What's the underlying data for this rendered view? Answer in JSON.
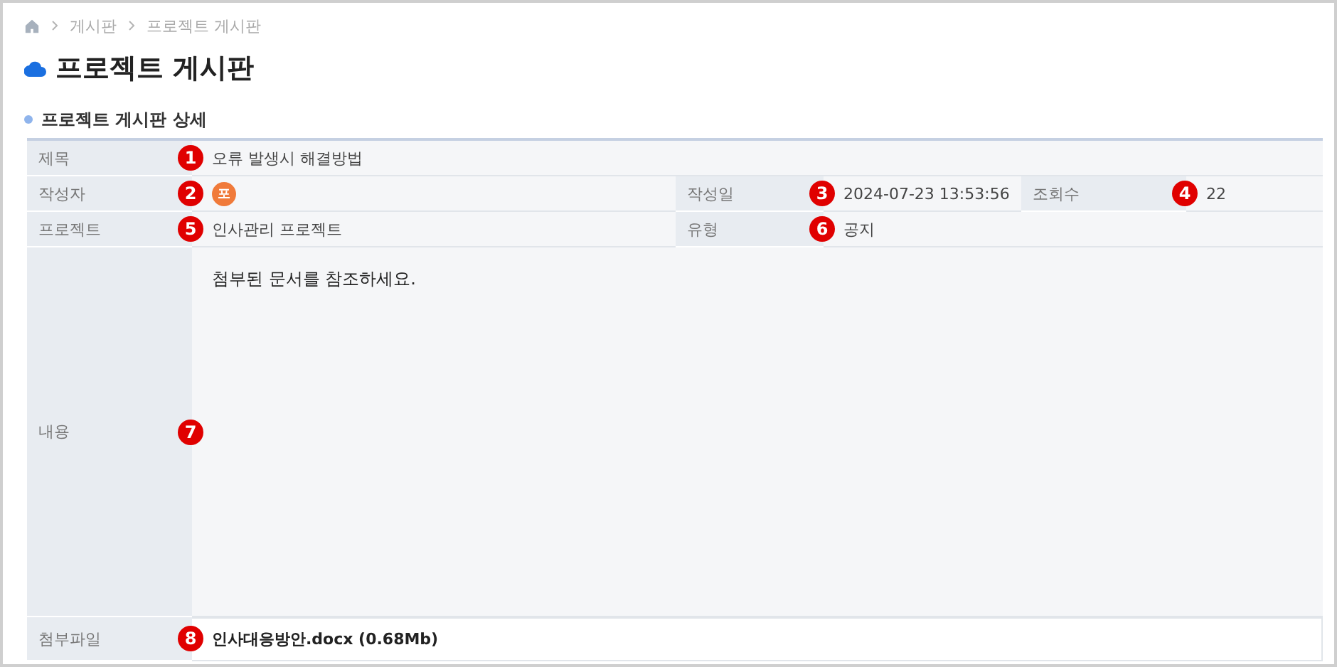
{
  "breadcrumb": [
    "게시판",
    "프로젝트 게시판"
  ],
  "page_title": "프로젝트 게시판",
  "section_title": "프로젝트 게시판 상세",
  "rows": [
    {
      "fields": [
        {
          "kind": "text",
          "label": "제목",
          "marker": "1",
          "value": "오류 발생시 해결방법"
        }
      ]
    },
    {
      "fields": [
        {
          "kind": "avatar",
          "label": "작성자",
          "marker": "2",
          "value": "포"
        },
        {
          "kind": "text",
          "label": "작성일",
          "marker": "3",
          "value": "2024-07-23 13:53:56"
        },
        {
          "kind": "text",
          "label": "조회수",
          "marker": "4",
          "value": "22"
        }
      ]
    },
    {
      "fields": [
        {
          "kind": "text",
          "label": "프로젝트",
          "marker": "5",
          "value": "인사관리 프로젝트"
        },
        {
          "kind": "text",
          "label": "유형",
          "marker": "6",
          "value": "공지"
        }
      ]
    },
    {
      "fields": [
        {
          "kind": "content",
          "label": "내용",
          "marker": "7",
          "value": "첨부된 문서를 참조하세요."
        }
      ]
    },
    {
      "fields": [
        {
          "kind": "file",
          "label": "첨부파일",
          "marker": "8",
          "value": "인사대응방안.docx (0.68Mb)"
        }
      ]
    }
  ]
}
